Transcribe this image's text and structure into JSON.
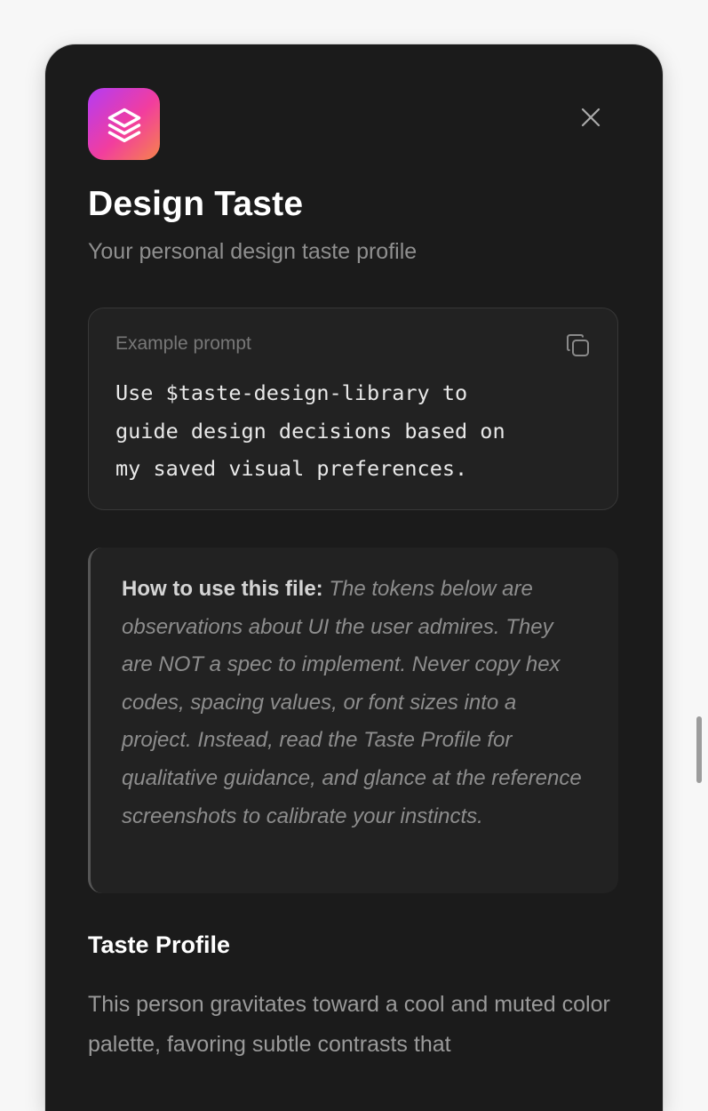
{
  "app": {
    "title": "Design Taste",
    "subtitle": "Your personal design taste profile",
    "icon": "layers-icon",
    "accent_gradient": [
      "#b33cf5",
      "#f23d9e",
      "#f6844a"
    ]
  },
  "close_icon": "close-icon",
  "prompt_card": {
    "label": "Example prompt",
    "copy_icon": "copy-icon",
    "text": "Use $taste-design-library to\nguide design decisions based on\nmy saved visual preferences."
  },
  "callout": {
    "lead": "How to use this file:",
    "body": "The tokens below are observations about UI the user admires. They are NOT a spec to implement. Never copy hex codes, spacing values, or font sizes into a project. Instead, read the Taste Profile for qualitative guidance, and glance at the reference screenshots to calibrate your instincts."
  },
  "taste_profile": {
    "heading": "Taste Profile",
    "body": "This person gravitates toward a cool and muted color palette, favoring subtle contrasts that"
  },
  "colors": {
    "modal_bg": "#1b1b1b",
    "card_bg": "#222222",
    "page_bg": "#f7f7f7"
  }
}
